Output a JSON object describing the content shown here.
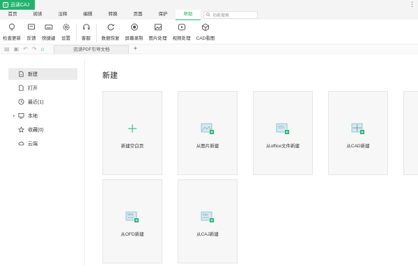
{
  "app": {
    "title": "迅读CAJ",
    "logo_glyph": "C"
  },
  "window": {
    "more_glyph": "⋮"
  },
  "menu": {
    "tabs": [
      "首页",
      "阅读",
      "注释",
      "编辑",
      "转换",
      "页面",
      "保护",
      "帮助"
    ],
    "active_index": 7,
    "search_placeholder": "功能搜索"
  },
  "ribbon": {
    "items": [
      {
        "label": "检查更新",
        "icon": "lightbulb-icon"
      },
      {
        "label": "反馈",
        "icon": "chat-icon"
      },
      {
        "label": "快捷键",
        "icon": "keyboard-icon"
      },
      {
        "label": "设置",
        "icon": "gear-icon"
      },
      {
        "label": "客服",
        "icon": "headset-icon"
      },
      {
        "label": "数据恢复",
        "icon": "restore-icon"
      },
      {
        "label": "屏幕录制",
        "icon": "record-icon"
      },
      {
        "label": "图片处理",
        "icon": "image-icon"
      },
      {
        "label": "视频处理",
        "icon": "video-icon"
      },
      {
        "label": "CAD看图",
        "icon": "cube-icon"
      }
    ]
  },
  "docbar": {
    "tab_label": "迅读PDF引导文档",
    "add_glyph": "+"
  },
  "sidebar": {
    "items": [
      {
        "label": "新建",
        "icon": "new-file-icon",
        "active": true
      },
      {
        "label": "打开",
        "icon": "open-file-icon"
      },
      {
        "label": "最近(1)",
        "icon": "clock-icon"
      },
      {
        "label": "本地",
        "icon": "monitor-icon",
        "expandable": true
      },
      {
        "label": "收藏(0)",
        "icon": "star-icon"
      },
      {
        "label": "云端",
        "icon": "cloud-icon"
      }
    ]
  },
  "main": {
    "title": "新建",
    "cards": [
      {
        "label": "新建空白页",
        "icon": "plus-icon"
      },
      {
        "label": "从图片新建",
        "icon": "image-file-icon"
      },
      {
        "label": "从office文件新建",
        "icon": "office-file-icon"
      },
      {
        "label": "从CAD新建",
        "icon": "cad-file-icon"
      },
      {
        "label": "从OFD新建",
        "icon": "ofd-file-icon",
        "badge": "OFD"
      },
      {
        "label": "从CAJ新建",
        "icon": "caj-file-icon",
        "badge": "CAJ"
      }
    ]
  },
  "colors": {
    "accent": "#23b26d",
    "icon_teal": "#7fb8c9",
    "card_bg": "#f7f7f7"
  }
}
